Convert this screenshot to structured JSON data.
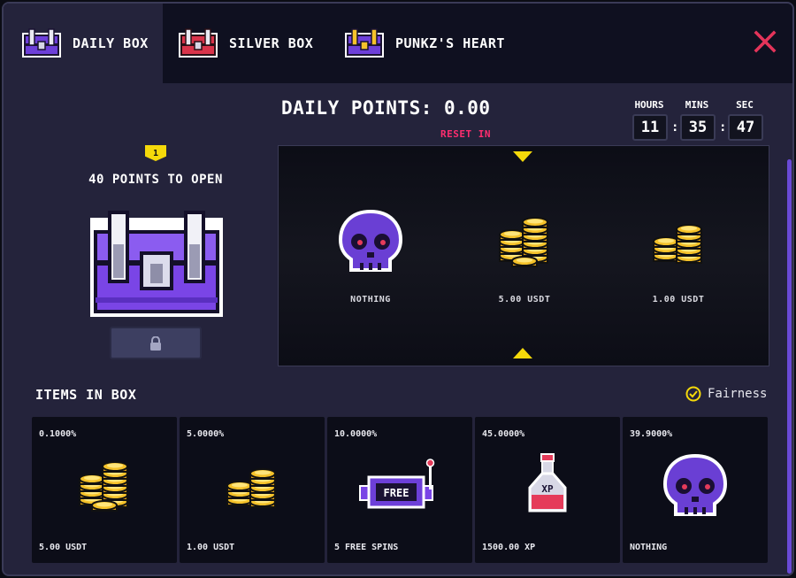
{
  "tabs": [
    {
      "label": "DAILY BOX",
      "icon": "purple-chest-icon",
      "active": true
    },
    {
      "label": "SILVER BOX",
      "icon": "red-chest-icon",
      "active": false
    },
    {
      "label": "PUNKZ'S HEART",
      "icon": "gold-chest-icon",
      "active": false
    }
  ],
  "header": {
    "daily_points_label": "DAILY POINTS: 0.00",
    "reset_label": "RESET IN"
  },
  "timer": {
    "hours_label": "HOURS",
    "mins_label": "MINS",
    "sec_label": "SEC",
    "hours": "11",
    "mins": "35",
    "sec": "47",
    "sep": ":"
  },
  "box": {
    "level": "1",
    "points_to_open": "40 POINTS TO OPEN"
  },
  "reel": [
    {
      "label": "NOTHING",
      "icon": "skull-icon"
    },
    {
      "label": "5.00 USDT",
      "icon": "coin-stack-large-icon"
    },
    {
      "label": "1.00 USDT",
      "icon": "coin-stack-small-icon"
    }
  ],
  "items_title": "ITEMS IN BOX",
  "fairness_label": "Fairness",
  "items": [
    {
      "chance": "0.1000%",
      "name": "5.00 USDT",
      "icon": "coin-stack-large-icon"
    },
    {
      "chance": "5.0000%",
      "name": "1.00 USDT",
      "icon": "coin-stack-small-icon"
    },
    {
      "chance": "10.0000%",
      "name": "5 FREE SPINS",
      "icon": "slot-machine-icon",
      "slot_text": "FREE"
    },
    {
      "chance": "45.0000%",
      "name": "1500.00 XP",
      "icon": "xp-potion-icon",
      "potion_text": "XP"
    },
    {
      "chance": "39.9000%",
      "name": "NOTHING",
      "icon": "skull-icon"
    }
  ],
  "colors": {
    "accent_yellow": "#f5d90a",
    "reset_pink": "#ff2d6f",
    "purple": "#6a4ad6"
  }
}
